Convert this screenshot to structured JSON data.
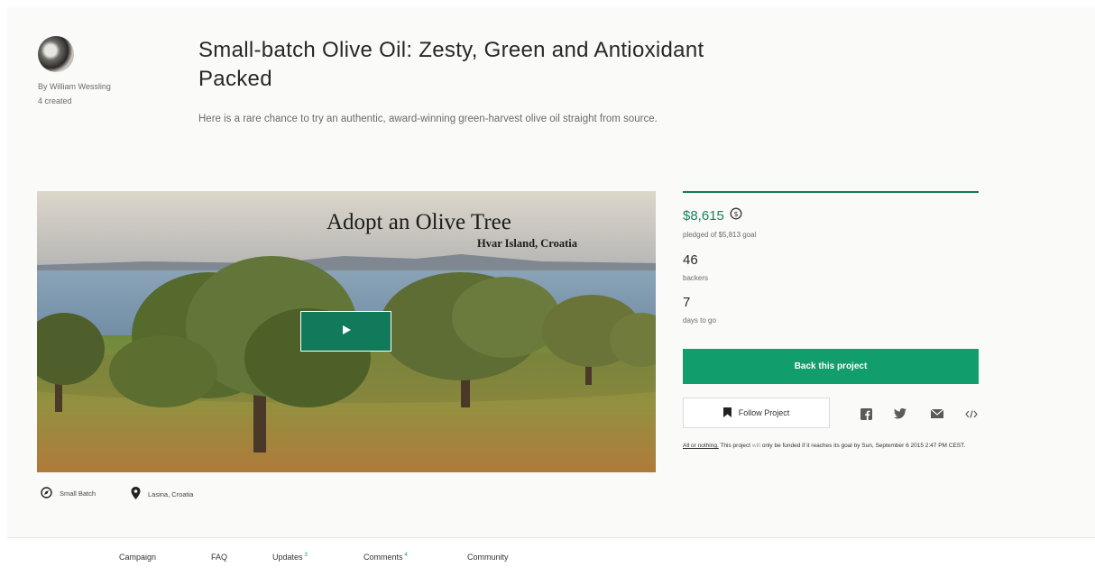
{
  "creator": {
    "name": "By William Wessling",
    "projects_created": "4 created"
  },
  "project": {
    "title": "Small-batch Olive Oil: Zesty, Green and Antioxidant Packed",
    "blurb": "Here is a rare chance to try an authentic, award-winning green-harvest olive oil straight from source.",
    "category": "Small Batch",
    "location": "Lasina, Croatia"
  },
  "video": {
    "title": "Adopt an Olive Tree",
    "subtitle": "Hvar Island, Croatia",
    "play_glyph": "▶"
  },
  "stats": {
    "pledged": "$8,615",
    "pledged_label": "pledged of $5,813 goal",
    "backers": "46",
    "backers_label": "backers",
    "days": "7",
    "days_label": "days to go"
  },
  "actions": {
    "back_label": "Back this project",
    "follow_label": "Follow Project",
    "share_icons": [
      "facebook-icon",
      "twitter-icon",
      "email-icon",
      "embed-icon"
    ]
  },
  "funding_note": {
    "model": "All or nothing.",
    "pre": "This project",
    "will": "will",
    "post": "only be funded if it reaches its goal by Sun, September 6 2015 2:47 PM CEST."
  },
  "nav": {
    "tabs": [
      {
        "label": "Campaign",
        "count": ""
      },
      {
        "label": "FAQ",
        "count": ""
      },
      {
        "label": "Updates",
        "count": "3"
      },
      {
        "label": "Comments",
        "count": "4"
      },
      {
        "label": "Community",
        "count": ""
      }
    ]
  },
  "colors": {
    "accent": "#119e6c",
    "accent_dark": "#117a5a",
    "pledged_text": "#16835f"
  }
}
